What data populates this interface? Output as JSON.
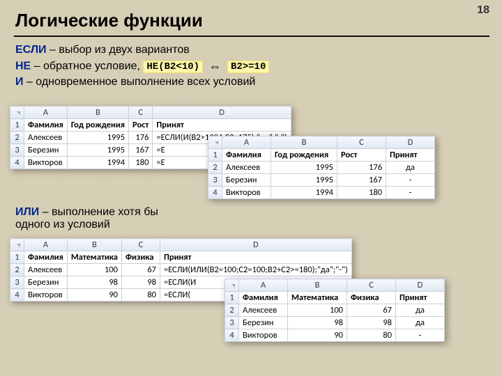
{
  "page_number": "18",
  "title": "Логические функции",
  "line1_kw": "ЕСЛИ",
  "line1_rest": " – выбор из двух вариантов",
  "line2_kw": "НЕ",
  "line2_rest": " – обратное условие,  ",
  "line2_code1": "НЕ(B2<10)",
  "line2_code2": "B2>=10",
  "line3_kw": "И",
  "line3_rest": " – одновременное выполнение всех условий",
  "ili_kw": "ИЛИ",
  "ili_rest1": " – выполнение хотя бы",
  "ili_rest2": "одного из условий",
  "t1": {
    "cols": [
      "A",
      "B",
      "C",
      "D"
    ],
    "h": [
      "Фамилия",
      "Год рождения",
      "Рост",
      "Принят"
    ],
    "rows": [
      [
        "Алексеев",
        "1995",
        "176",
        "=ЕСЛИ(И(B2>1994;C2>175);\"да\";\"-\")"
      ],
      [
        "Березин",
        "1995",
        "167",
        "=Е"
      ],
      [
        "Викторов",
        "1994",
        "180",
        "=Е"
      ]
    ]
  },
  "t2": {
    "cols": [
      "A",
      "B",
      "C",
      "D"
    ],
    "h": [
      "Фамилия",
      "Год рождения",
      "Рост",
      "Принят"
    ],
    "rows": [
      [
        "Алексеев",
        "1995",
        "176",
        "да"
      ],
      [
        "Березин",
        "1995",
        "167",
        "-"
      ],
      [
        "Викторов",
        "1994",
        "180",
        "-"
      ]
    ]
  },
  "t3": {
    "cols": [
      "A",
      "B",
      "C",
      "D"
    ],
    "h": [
      "Фамилия",
      "Математика",
      "Физика",
      "Принят"
    ],
    "rows": [
      [
        "Алексеев",
        "100",
        "67",
        "=ЕСЛИ(ИЛИ(B2=100;C2=100;B2+C2>=180);\"да\";\"-\")"
      ],
      [
        "Березин",
        "98",
        "98",
        "=ЕСЛИ(И"
      ],
      [
        "Викторов",
        "90",
        "80",
        "=ЕСЛИ("
      ]
    ]
  },
  "t4": {
    "cols": [
      "A",
      "B",
      "C",
      "D"
    ],
    "h": [
      "Фамилия",
      "Математика",
      "Физика",
      "Принят"
    ],
    "rows": [
      [
        "Алексеев",
        "100",
        "67",
        "да"
      ],
      [
        "Березин",
        "98",
        "98",
        "да"
      ],
      [
        "Викторов",
        "90",
        "80",
        "-"
      ]
    ]
  }
}
